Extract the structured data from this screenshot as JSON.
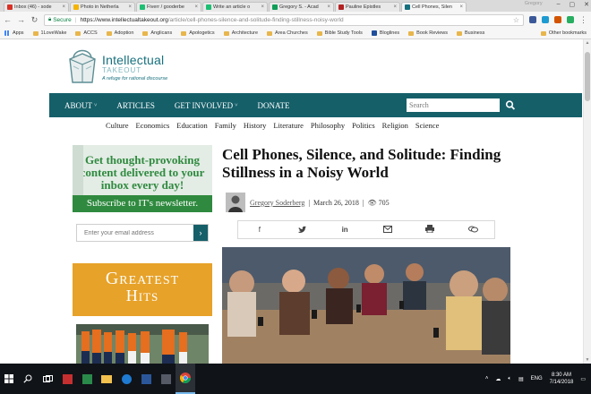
{
  "browser": {
    "tabs": [
      {
        "title": "Inbox (46) - sode",
        "color": "#d93025",
        "active": false
      },
      {
        "title": "Photo in Netherla",
        "color": "#f4b400",
        "active": false
      },
      {
        "title": "Fiverr / gooderbe",
        "color": "#1dbf73",
        "active": false
      },
      {
        "title": "Write an article o",
        "color": "#1dbf73",
        "active": false
      },
      {
        "title": "Gregory S. - Acad",
        "color": "#0f9d58",
        "active": false
      },
      {
        "title": "Pauline Epistles",
        "color": "#b22222",
        "active": false
      },
      {
        "title": "Cell Phones, Silen",
        "color": "#17707e",
        "active": true
      }
    ],
    "user_label": "Gregory",
    "address": {
      "secure_label": "Secure",
      "host": "https://www.intellectualtakeout.org",
      "path": "/article/cell-phones-silence-and-solitude-finding-stillness-noisy-world"
    },
    "bookmarks": [
      {
        "label": "Apps",
        "type": "apps"
      },
      {
        "label": "1LoveWake",
        "type": "folder"
      },
      {
        "label": "ACCS",
        "type": "folder"
      },
      {
        "label": "Adoption",
        "type": "folder"
      },
      {
        "label": "Anglicans",
        "type": "folder"
      },
      {
        "label": "Apologetics",
        "type": "folder"
      },
      {
        "label": "Architecture",
        "type": "folder"
      },
      {
        "label": "Area Churches",
        "type": "folder"
      },
      {
        "label": "Bible Study Tools",
        "type": "folder"
      },
      {
        "label": "Bloglines",
        "type": "site"
      },
      {
        "label": "Book Reviews",
        "type": "folder"
      },
      {
        "label": "Business",
        "type": "folder"
      }
    ],
    "other_bookmarks": "Other bookmarks"
  },
  "site": {
    "logo": {
      "line1": "Intellectual",
      "line2": "TAKEOUT",
      "tagline": "A refuge for rational discourse"
    },
    "main_nav": [
      {
        "label": "ABOUT",
        "has_menu": true
      },
      {
        "label": "ARTICLES",
        "has_menu": false
      },
      {
        "label": "GET INVOLVED",
        "has_menu": true
      },
      {
        "label": "DONATE",
        "has_menu": false
      }
    ],
    "search_placeholder": "Search",
    "categories": [
      "Culture",
      "Economics",
      "Education",
      "Family",
      "History",
      "Literature",
      "Philosophy",
      "Politics",
      "Religion",
      "Science"
    ]
  },
  "sidebar": {
    "promo_text": "Get thought-provoking content delivered to your inbox every day!",
    "subscribe_label": "Subscribe to IT's newsletter.",
    "email_placeholder": "Enter your email address",
    "greatest_line1": "Greatest",
    "greatest_line2": "Hits"
  },
  "article": {
    "title": "Cell Phones, Silence, and Solitude: Finding Stillness in a Noisy World",
    "author": "Gregory Soderberg",
    "date": "March 26, 2018",
    "views": "705",
    "share_icons": [
      "facebook-icon",
      "twitter-icon",
      "linkedin-icon",
      "email-icon",
      "print-icon",
      "comments-icon"
    ]
  },
  "taskbar": {
    "lang": "ENG",
    "time": "8:30 AM",
    "date": "7/14/2018"
  }
}
